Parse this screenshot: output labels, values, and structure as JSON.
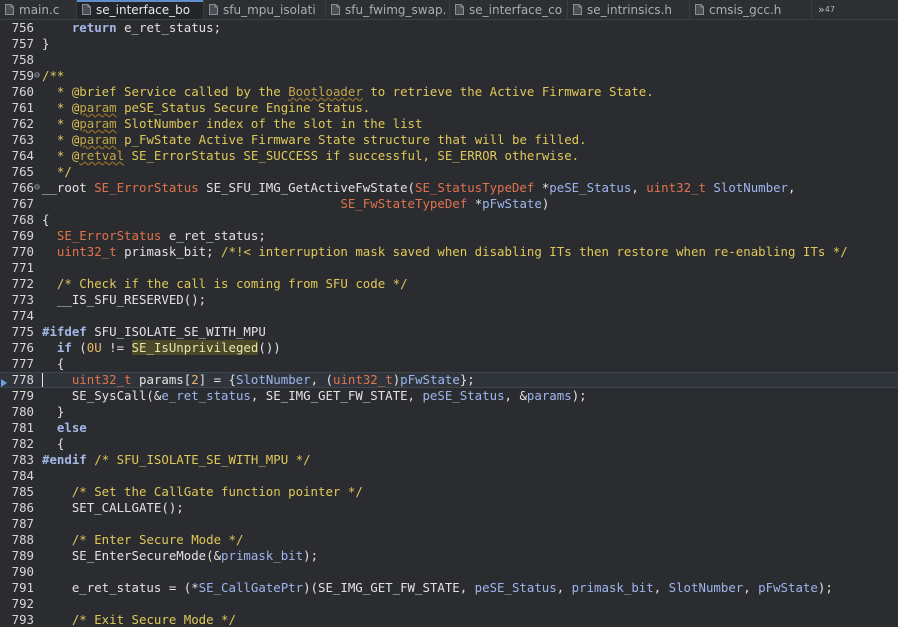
{
  "tabs": [
    {
      "label": "main.c",
      "active": false
    },
    {
      "label": "se_interface_bo",
      "active": true
    },
    {
      "label": "sfu_mpu_isolati",
      "active": false
    },
    {
      "label": "sfu_fwimg_swap.",
      "active": false
    },
    {
      "label": "se_interface_co",
      "active": false
    },
    {
      "label": "se_intrinsics.h",
      "active": false
    },
    {
      "label": "cmsis_gcc.h",
      "active": false
    }
  ],
  "tab_overflow": {
    "chevron": "»",
    "count": "47"
  },
  "colors": {
    "keyword": "#a3b7e8",
    "type": "#e0734f",
    "comment": "#e0c85a",
    "background": "#2a2c2f"
  },
  "editor": {
    "current_line": "778",
    "lines": [
      {
        "num": "756",
        "fold": "",
        "seg": [
          [
            "    ",
            "p"
          ],
          [
            "return",
            "kw"
          ],
          [
            " e_ret_status;",
            "p"
          ]
        ]
      },
      {
        "num": "757",
        "fold": "",
        "seg": [
          [
            "}",
            "p"
          ]
        ]
      },
      {
        "num": "758",
        "fold": "",
        "seg": []
      },
      {
        "num": "759",
        "fold": "⊖",
        "seg": [
          [
            "/**",
            "cm"
          ]
        ]
      },
      {
        "num": "760",
        "fold": "",
        "seg": [
          [
            "  * @brief Service called by the ",
            "cm"
          ],
          [
            "Bootloader",
            "tag"
          ],
          [
            " to retrieve the Active Firmware State.",
            "cm"
          ]
        ]
      },
      {
        "num": "761",
        "fold": "",
        "seg": [
          [
            "  * @",
            "cm"
          ],
          [
            "param",
            "tag"
          ],
          [
            " peSE_Status Secure Engine Status.",
            "cm"
          ]
        ]
      },
      {
        "num": "762",
        "fold": "",
        "seg": [
          [
            "  * @",
            "cm"
          ],
          [
            "param",
            "tag"
          ],
          [
            " SlotNumber index of the slot in the list",
            "cm"
          ]
        ]
      },
      {
        "num": "763",
        "fold": "",
        "seg": [
          [
            "  * @",
            "cm"
          ],
          [
            "param",
            "tag"
          ],
          [
            " p_FwState Active Firmware State structure that will be filled.",
            "cm"
          ]
        ]
      },
      {
        "num": "764",
        "fold": "",
        "seg": [
          [
            "  * @",
            "cm"
          ],
          [
            "retval",
            "tag"
          ],
          [
            " SE_ErrorStatus SE_SUCCESS if successful, SE_ERROR otherwise.",
            "cm"
          ]
        ]
      },
      {
        "num": "765",
        "fold": "",
        "seg": [
          [
            "  */",
            "cm"
          ]
        ]
      },
      {
        "num": "766",
        "fold": "⊖",
        "seg": [
          [
            "__root ",
            "p"
          ],
          [
            "SE_ErrorStatus",
            "ty"
          ],
          [
            " SE_SFU_IMG_GetActiveFwState(",
            "p"
          ],
          [
            "SE_StatusTypeDef",
            "ty"
          ],
          [
            " *",
            "p"
          ],
          [
            "peSE_Status",
            "pm"
          ],
          [
            ", ",
            "p"
          ],
          [
            "uint32_t",
            "ty"
          ],
          [
            " ",
            "p"
          ],
          [
            "SlotNumber",
            "pm"
          ],
          [
            ",",
            "p"
          ]
        ]
      },
      {
        "num": "767",
        "fold": "",
        "seg": [
          [
            "                                        ",
            "p"
          ],
          [
            "SE_FwStateTypeDef",
            "ty"
          ],
          [
            " *",
            "p"
          ],
          [
            "pFwState",
            "pm"
          ],
          [
            ")",
            "p"
          ]
        ]
      },
      {
        "num": "768",
        "fold": "",
        "seg": [
          [
            "{",
            "p"
          ]
        ]
      },
      {
        "num": "769",
        "fold": "",
        "seg": [
          [
            "  ",
            "p"
          ],
          [
            "SE_ErrorStatus",
            "ty"
          ],
          [
            " e_ret_status;",
            "p"
          ]
        ]
      },
      {
        "num": "770",
        "fold": "",
        "seg": [
          [
            "  ",
            "p"
          ],
          [
            "uint32_t",
            "ty"
          ],
          [
            " primask_bit; ",
            "p"
          ],
          [
            "/*!< interruption mask saved when disabling ITs then restore when re-enabling ITs */",
            "cm"
          ]
        ]
      },
      {
        "num": "771",
        "fold": "",
        "seg": []
      },
      {
        "num": "772",
        "fold": "",
        "seg": [
          [
            "  ",
            "p"
          ],
          [
            "/* Check if the call is coming from SFU code */",
            "cm"
          ]
        ]
      },
      {
        "num": "773",
        "fold": "",
        "seg": [
          [
            "  __IS_SFU_RESERVED();",
            "p"
          ]
        ]
      },
      {
        "num": "774",
        "fold": "",
        "seg": []
      },
      {
        "num": "775",
        "fold": "",
        "seg": [
          [
            "#ifdef",
            "pp"
          ],
          [
            " SFU_ISOLATE_SE_WITH_MPU",
            "p"
          ]
        ]
      },
      {
        "num": "776",
        "fold": "",
        "seg": [
          [
            "  ",
            "p"
          ],
          [
            "if",
            "kw"
          ],
          [
            " (",
            "p"
          ],
          [
            "0U",
            "num"
          ],
          [
            " != ",
            "p"
          ],
          [
            "SE_IsUnprivileged",
            "hl"
          ],
          [
            "())",
            "p"
          ]
        ]
      },
      {
        "num": "777",
        "fold": "",
        "seg": [
          [
            "  {",
            "p"
          ]
        ]
      },
      {
        "num": "778",
        "fold": "",
        "seg": [
          [
            "    ",
            "p"
          ],
          [
            "uint32_t",
            "ty"
          ],
          [
            " params[",
            "p"
          ],
          [
            "2",
            "num"
          ],
          [
            "] = {",
            "p"
          ],
          [
            "SlotNumber",
            "pm"
          ],
          [
            ", (",
            "p"
          ],
          [
            "uint32_t",
            "ty"
          ],
          [
            ")",
            "p"
          ],
          [
            "pFwState",
            "pm"
          ],
          [
            "};",
            "p"
          ]
        ]
      },
      {
        "num": "779",
        "fold": "",
        "seg": [
          [
            "    SE_SysCall(&",
            "p"
          ],
          [
            "e_ret_status",
            "pm"
          ],
          [
            ", SE_IMG_GET_FW_STATE, ",
            "p"
          ],
          [
            "peSE_Status",
            "pm"
          ],
          [
            ", &",
            "p"
          ],
          [
            "params",
            "pm"
          ],
          [
            ");",
            "p"
          ]
        ]
      },
      {
        "num": "780",
        "fold": "",
        "seg": [
          [
            "  }",
            "p"
          ]
        ]
      },
      {
        "num": "781",
        "fold": "",
        "seg": [
          [
            "  ",
            "p"
          ],
          [
            "else",
            "kw"
          ]
        ]
      },
      {
        "num": "782",
        "fold": "",
        "seg": [
          [
            "  {",
            "p"
          ]
        ]
      },
      {
        "num": "783",
        "fold": "",
        "seg": [
          [
            "#endif",
            "pp"
          ],
          [
            " ",
            "p"
          ],
          [
            "/* SFU_ISOLATE_SE_WITH_MPU */",
            "cm"
          ]
        ]
      },
      {
        "num": "784",
        "fold": "",
        "seg": []
      },
      {
        "num": "785",
        "fold": "",
        "seg": [
          [
            "    ",
            "p"
          ],
          [
            "/* Set the CallGate function pointer */",
            "cm"
          ]
        ]
      },
      {
        "num": "786",
        "fold": "",
        "seg": [
          [
            "    SET_CALLGATE();",
            "p"
          ]
        ]
      },
      {
        "num": "787",
        "fold": "",
        "seg": []
      },
      {
        "num": "788",
        "fold": "",
        "seg": [
          [
            "    ",
            "p"
          ],
          [
            "/* Enter Secure Mode */",
            "cm"
          ]
        ]
      },
      {
        "num": "789",
        "fold": "",
        "seg": [
          [
            "    SE_EnterSecureMode(&",
            "p"
          ],
          [
            "primask_bit",
            "pm"
          ],
          [
            ");",
            "p"
          ]
        ]
      },
      {
        "num": "790",
        "fold": "",
        "seg": []
      },
      {
        "num": "791",
        "fold": "",
        "seg": [
          [
            "    e_ret_status = (*",
            "p"
          ],
          [
            "SE_CallGatePtr",
            "pm"
          ],
          [
            ")(SE_IMG_GET_FW_STATE, ",
            "p"
          ],
          [
            "peSE_Status",
            "pm"
          ],
          [
            ", ",
            "p"
          ],
          [
            "primask_bit",
            "pm"
          ],
          [
            ", ",
            "p"
          ],
          [
            "SlotNumber",
            "pm"
          ],
          [
            ", ",
            "p"
          ],
          [
            "pFwState",
            "pm"
          ],
          [
            ");",
            "p"
          ]
        ]
      },
      {
        "num": "792",
        "fold": "",
        "seg": []
      },
      {
        "num": "793",
        "fold": "",
        "seg": [
          [
            "    ",
            "p"
          ],
          [
            "/* Exit Secure Mode */",
            "cm"
          ]
        ]
      }
    ]
  }
}
